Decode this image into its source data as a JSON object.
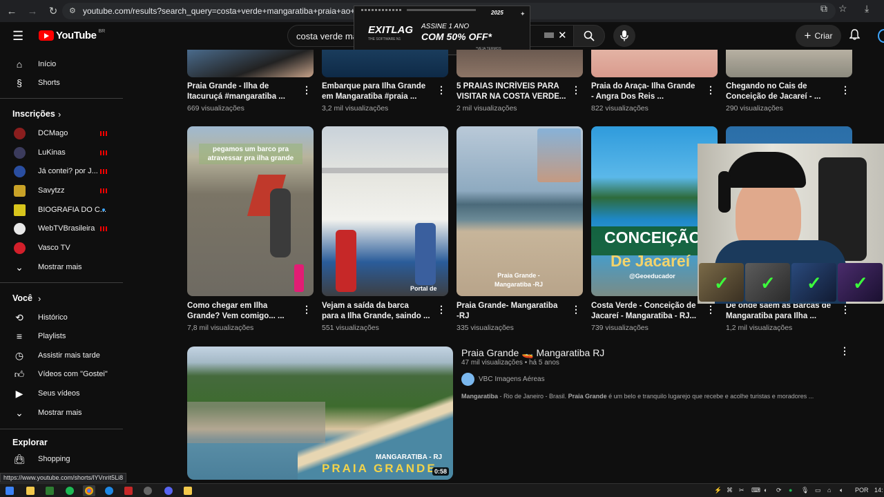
{
  "browser": {
    "url": "youtube.com/results?search_query=costa+verde+mangaratiba+praia+ao+vivo+ilha"
  },
  "header": {
    "logo_text": "YouTube",
    "logo_country": "BR",
    "search_value": "costa verde ma",
    "create_label": "Criar"
  },
  "ad": {
    "brand": "EXITLAG",
    "brand_sub": "THE SOFTWARE N1",
    "line1": "ASSINE 1 ANO",
    "line2": "COM 50% OFF*",
    "line3": "*VEJA TERMOS",
    "badge": "2025"
  },
  "sidebar": {
    "main": [
      {
        "label": "Início",
        "icon": "home-icon"
      },
      {
        "label": "Shorts",
        "icon": "shorts-icon"
      }
    ],
    "subs_heading": "Inscrições",
    "subs": [
      {
        "label": "DCMago",
        "color": "#8b1e1e"
      },
      {
        "label": "LuKinas",
        "color": "#3b3b5c"
      },
      {
        "label": "Já contei? por J...",
        "color": "#2a4ea0"
      },
      {
        "label": "Savytzz",
        "color": "#c9a227"
      },
      {
        "label": "BIOGRAFIA DO C...",
        "color": "#d8c51c"
      },
      {
        "label": "WebTVBrasileira",
        "color": "#e8e8e8"
      },
      {
        "label": "Vasco TV",
        "color": "#d21f2a"
      }
    ],
    "show_more": "Mostrar mais",
    "you_heading": "Você",
    "you": [
      {
        "label": "Histórico",
        "icon": "history-icon"
      },
      {
        "label": "Playlists",
        "icon": "playlists-icon"
      },
      {
        "label": "Assistir mais tarde",
        "icon": "watch-later-icon"
      },
      {
        "label": "Vídeos com \"Gostei\"",
        "icon": "like-icon"
      },
      {
        "label": "Seus vídeos",
        "icon": "your-videos-icon"
      },
      {
        "label": "Mostrar mais",
        "icon": "chevron-down-icon"
      }
    ],
    "explore_heading": "Explorar",
    "explore": [
      {
        "label": "Shopping",
        "icon": "shopping-icon"
      }
    ]
  },
  "row1": [
    {
      "title1": "Praia Grande - Ilha de",
      "title2": "Itacuruçá #mangaratiba ...",
      "views": "669 visualizações"
    },
    {
      "title1": "Embarque para Ilha Grande",
      "title2": "em Mangaratiba #praia ...",
      "views": "3,2 mil visualizações"
    },
    {
      "title1": "5 PRAIAS INCRÍVEIS PARA",
      "title2": "VISITAR NA COSTA VERDE...",
      "views": "2 mil visualizações"
    },
    {
      "title1": "Praia do Araça- Ilha Grande",
      "title2": "- Angra Dos Reis ...",
      "views": "822 visualizações"
    },
    {
      "title1": "Chegando no Cais de",
      "title2": "Conceição de Jacareí - ...",
      "views": "290 visualizações"
    }
  ],
  "row2": [
    {
      "title1": "Como chegar em Ilha",
      "title2": "Grande? Vem comigo... ...",
      "views": "7,8 mil visualizações",
      "overlay": "pegamos um barco pra atravessar pra ilha grande"
    },
    {
      "title1": "Vejam a saída da barca",
      "title2": "para a Ilha Grande, saindo ...",
      "views": "551 visualizações",
      "overlay": "Portal de"
    },
    {
      "title1": "Praia Grande- Mangaratiba",
      "title2": "-RJ",
      "views": "335 visualizações",
      "overlay": "Praia Grande - Mangaratiba -RJ"
    },
    {
      "title1": "Costa Verde - Conceição de",
      "title2": "Jacareí - Mangaratiba - RJ...",
      "views": "739 visualizações",
      "overlay1": "CONCEIÇÃO",
      "overlay2": "De Jacareí",
      "overlay3": "@Geoeducador"
    },
    {
      "title1": "De onde saem as Barcas de",
      "title2": "Mangaratiba para Ilha ...",
      "views": "1,2 mil visualizações"
    }
  ],
  "featured": {
    "title": "Praia Grande 🚤 Mangaratiba RJ",
    "meta": "47 mil visualizações • há 5 anos",
    "channel": "VBC Imagens Aéreas",
    "desc_b1": "Mangaratiba",
    "desc_t1": " - Rio de Janeiro - Brasil. ",
    "desc_b2": "Praia Grande",
    "desc_t2": " é um belo e tranquilo lugarejo que recebe e acolhe turistas e moradores ...",
    "thumb_top": "MANGARATIBA - RJ",
    "thumb_bottom": "PRAIA GRANDE",
    "duration": "0:58"
  },
  "status_url": "https://www.youtube.com/shorts/lYVnrit5Li8",
  "taskbar": {
    "lang": "POR",
    "time": "14:"
  }
}
